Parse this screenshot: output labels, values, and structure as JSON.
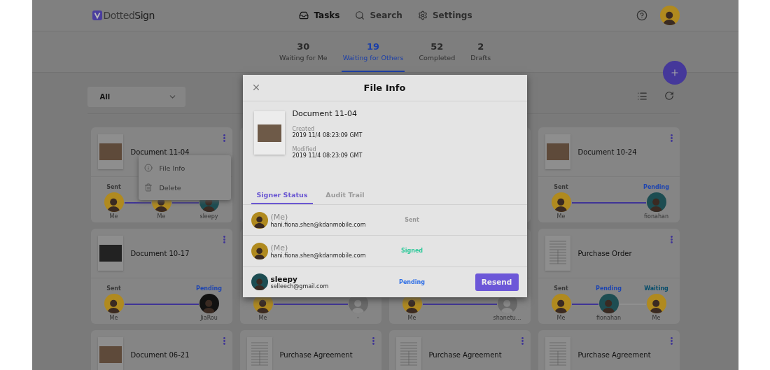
{
  "header": {
    "logo": "Dotted**Sign**",
    "nav": [
      {
        "kind": "tasks",
        "label": "Tasks",
        "selected": true
      },
      {
        "kind": "search",
        "label": "Search",
        "selected": false
      },
      {
        "kind": "settings",
        "label": "Settings",
        "selected": false
      }
    ]
  },
  "status_tabs": [
    {
      "count": "30",
      "label": "Waiting for Me",
      "selected": false
    },
    {
      "count": "19",
      "label": "Waiting for Others",
      "selected": true
    },
    {
      "count": "52",
      "label": "Completed",
      "selected": false
    },
    {
      "count": "2",
      "label": "Drafts",
      "selected": false
    }
  ],
  "filter": {
    "value": "All"
  },
  "cards": [
    {
      "title": "Document 11-04",
      "thumbnail": {
        "kind": "photo"
      },
      "signers": [
        {
          "status": "Sent",
          "kind": "sent",
          "name": "Me",
          "avatar": {
            "kind": "woman"
          }
        },
        {
          "name": "Me",
          "avatar": {
            "kind": "woman"
          }
        },
        {
          "name": "sleepy",
          "avatar": {
            "kind": "man"
          }
        }
      ],
      "menu": [
        {
          "kind": "info",
          "label": "File Info"
        },
        {
          "kind": "delete",
          "label": "Delete"
        }
      ]
    },
    {
      "title": "Document 10-24",
      "thumbnail": {
        "kind": "photo"
      },
      "signers": [
        {
          "status": "Sent",
          "kind": "sent",
          "name": "Me",
          "avatar": {
            "kind": "woman"
          }
        },
        {
          "status": "Pending",
          "kind": "pending",
          "name": "fionahan",
          "avatar": {
            "kind": "man"
          }
        }
      ]
    },
    {
      "title": "Document 10-17",
      "thumbnail": {
        "kind": "dark-photo"
      },
      "signers": [
        {
          "status": "Sent",
          "kind": "sent",
          "name": "Me",
          "avatar": {
            "kind": "woman"
          }
        },
        {
          "status": "Pending",
          "kind": "pending",
          "name": "JiaRou",
          "avatar": {
            "kind": "logo"
          }
        }
      ]
    },
    {
      "signers": [
        {
          "name": "Me",
          "avatar": {
            "kind": "woman"
          }
        },
        {
          "name": "-",
          "avatar": {
            "kind": "empty"
          }
        }
      ]
    },
    {
      "signers": [
        {
          "name": "Me",
          "avatar": {
            "kind": "woman"
          }
        },
        {
          "name": "shanetu...",
          "avatar": {
            "kind": "empty"
          }
        }
      ]
    },
    {
      "title": "Purchase Order",
      "thumbnail": {
        "kind": "form"
      },
      "signers": [
        {
          "status": "Sent",
          "kind": "sent",
          "name": "Me",
          "avatar": {
            "kind": "woman"
          }
        },
        {
          "status": "Pending",
          "kind": "pending",
          "name": "fionahan",
          "avatar": {
            "kind": "man"
          }
        },
        {
          "status": "Waiting",
          "kind": "waiting",
          "name": "Me",
          "avatar": {
            "kind": "woman"
          }
        }
      ]
    },
    {
      "title": "Document 06-21",
      "thumbnail": {
        "kind": "photo"
      }
    },
    {
      "title": "Purchase Agreement",
      "thumbnail": {
        "kind": "form"
      }
    },
    {
      "title": "Purchase Agreement",
      "thumbnail": {
        "kind": "form"
      }
    },
    {
      "title": "Purchase Agreement",
      "thumbnail": {
        "kind": "form"
      }
    }
  ],
  "modal": {
    "title": "File Info",
    "document": "Document 11-04",
    "created_label": "Created",
    "created": "2019 11/4 08:23:09 GMT",
    "modified_label": "Modified",
    "modified": "2019 11/4 08:23:09 GMT",
    "tabs": [
      {
        "label": "Signer Status",
        "selected": true
      },
      {
        "label": "Audit Trail",
        "selected": false
      }
    ],
    "signers": [
      {
        "kind": "self",
        "name": "(Me)",
        "email": "hani.fiona.shen@kdanmobile.com",
        "status": {
          "label": "Sent",
          "kind": "sent"
        },
        "avatar": {
          "kind": "woman"
        }
      },
      {
        "kind": "self",
        "name": "(Me)",
        "email": "hani.fiona.shen@kdanmobile.com",
        "status": {
          "label": "Signed",
          "kind": "signed"
        },
        "avatar": {
          "kind": "woman"
        }
      },
      {
        "kind": "other",
        "name": "sleepy",
        "email": "selleech@gmail.com",
        "status": {
          "label": "Pending",
          "kind": "pending"
        },
        "avatar": {
          "kind": "man"
        },
        "action": "Resend"
      }
    ]
  }
}
